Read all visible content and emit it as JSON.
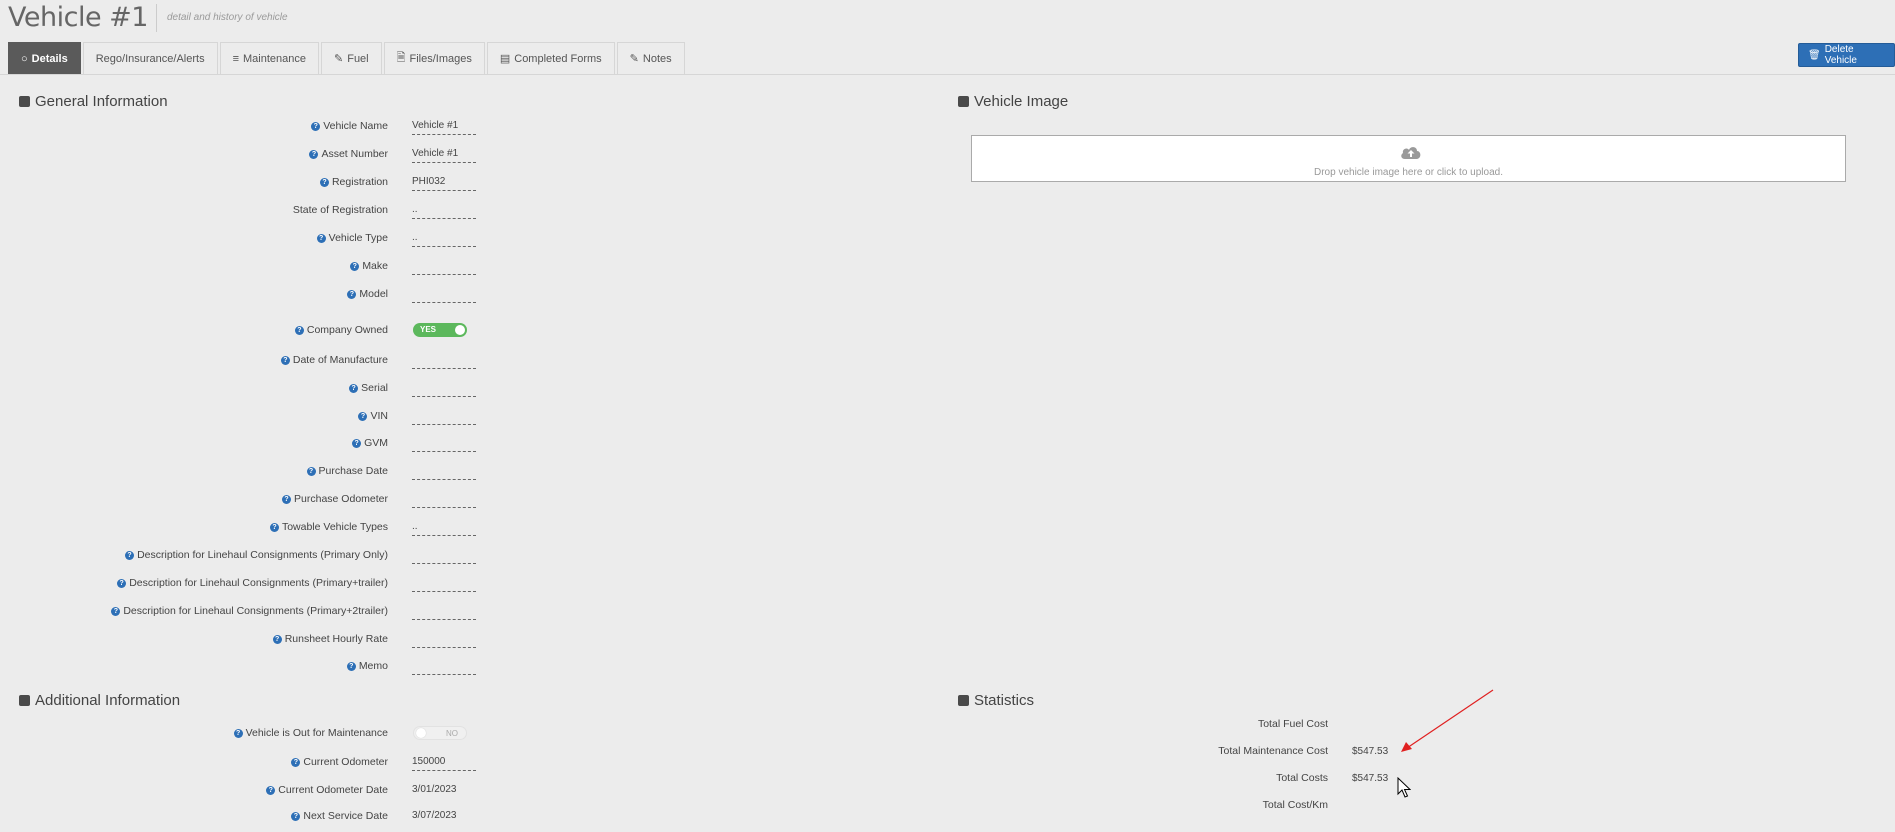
{
  "header": {
    "title": "Vehicle #1",
    "subtitle": "detail and history of vehicle"
  },
  "tabs": [
    {
      "label": "Details",
      "icon": "circle-icon"
    },
    {
      "label": "Rego/Insurance/Alerts"
    },
    {
      "label": "Maintenance",
      "icon": "list-icon"
    },
    {
      "label": "Fuel",
      "icon": "pencil-icon"
    },
    {
      "label": "Files/Images",
      "icon": "file-image-icon"
    },
    {
      "label": "Completed Forms",
      "icon": "form-icon"
    },
    {
      "label": "Notes",
      "icon": "pencil-icon"
    }
  ],
  "delete_button": "Delete Vehicle",
  "general": {
    "heading": "General Information",
    "vehicle_name": {
      "label": "Vehicle Name",
      "value": "Vehicle #1"
    },
    "asset_number": {
      "label": "Asset Number",
      "value": "Vehicle #1"
    },
    "registration": {
      "label": "Registration",
      "value": "PHI032"
    },
    "state": {
      "label": "State of Registration",
      "value": ".."
    },
    "vehicle_type": {
      "label": "Vehicle Type",
      "value": ".."
    },
    "make": {
      "label": "Make",
      "value": ""
    },
    "model": {
      "label": "Model",
      "value": ""
    },
    "company_owned": {
      "label": "Company Owned",
      "value": "YES"
    },
    "date_of_manufacture": {
      "label": "Date of Manufacture",
      "value": ""
    },
    "serial": {
      "label": "Serial",
      "value": ""
    },
    "vin": {
      "label": "VIN",
      "value": ""
    },
    "gvm": {
      "label": "GVM",
      "value": ""
    },
    "purchase_date": {
      "label": "Purchase Date",
      "value": ""
    },
    "purchase_odometer": {
      "label": "Purchase Odometer",
      "value": ""
    },
    "towable": {
      "label": "Towable Vehicle Types",
      "value": ".."
    },
    "desc_primary": {
      "label": "Description for Linehaul Consignments (Primary Only)",
      "value": ""
    },
    "desc_trailer": {
      "label": "Description for Linehaul Consignments (Primary+trailer)",
      "value": ""
    },
    "desc_2trailer": {
      "label": "Description for Linehaul Consignments (Primary+2trailer)",
      "value": ""
    },
    "runsheet_rate": {
      "label": "Runsheet Hourly Rate",
      "value": ""
    },
    "memo": {
      "label": "Memo",
      "value": ""
    }
  },
  "additional": {
    "heading": "Additional Information",
    "out_for_maintenance": {
      "label": "Vehicle is Out for Maintenance",
      "value": "NO"
    },
    "current_odometer": {
      "label": "Current Odometer",
      "value": "150000"
    },
    "current_odometer_date": {
      "label": "Current Odometer Date",
      "value": "3/01/2023"
    },
    "next_service_date": {
      "label": "Next Service Date",
      "value": "3/07/2023"
    }
  },
  "vehicle_image": {
    "heading": "Vehicle Image",
    "dropzone_text": "Drop vehicle image here or click to upload."
  },
  "statistics": {
    "heading": "Statistics",
    "total_fuel_cost": {
      "label": "Total Fuel Cost",
      "value": ""
    },
    "total_maintenance_cost": {
      "label": "Total Maintenance Cost",
      "value": "$547.53"
    },
    "total_costs": {
      "label": "Total Costs",
      "value": "$547.53"
    },
    "total_cost_km": {
      "label": "Total Cost/Km",
      "value": ""
    }
  },
  "colors": {
    "accent": "#2d6fb6",
    "toggle_on": "#5cb85c",
    "active_tab": "#5a5a5a",
    "annotation_arrow": "#e02020"
  }
}
